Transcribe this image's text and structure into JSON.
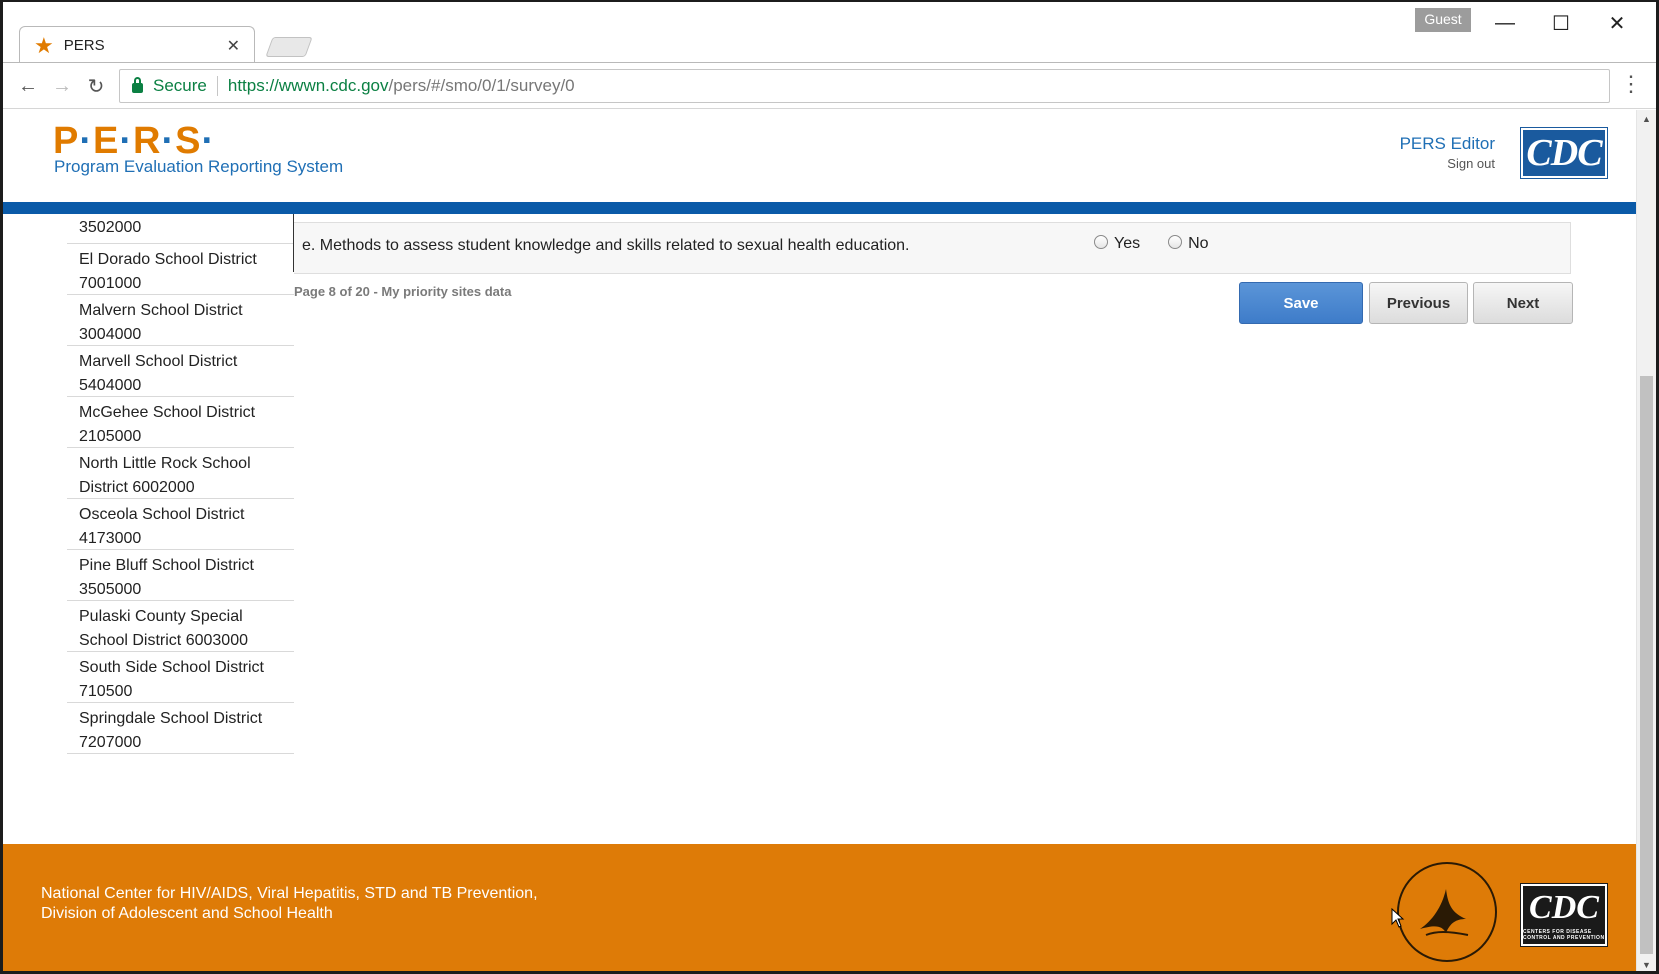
{
  "browser": {
    "tab_title": "PERS",
    "profile": "Guest",
    "secure_label": "Secure",
    "url_host": "https://wwwn.cdc.gov",
    "url_path": "/pers/#/smo/0/1/survey/0"
  },
  "header": {
    "logo_text": "P·E·R·S·",
    "logo_letters": [
      "P",
      "E",
      "R",
      "S"
    ],
    "subtitle": "Program Evaluation Reporting System",
    "user_name": "PERS Editor",
    "signout": "Sign out",
    "cdc_logo": "CDC"
  },
  "sidebar": {
    "items": [
      {
        "line1": "",
        "line2": "3502000"
      },
      {
        "line1": "El Dorado School District",
        "line2": "7001000"
      },
      {
        "line1": "Malvern School District",
        "line2": "3004000"
      },
      {
        "line1": "Marvell School District",
        "line2": "5404000"
      },
      {
        "line1": "McGehee School District",
        "line2": "2105000"
      },
      {
        "line1": "North Little Rock School",
        "line2": "District 6002000"
      },
      {
        "line1": "Osceola School District",
        "line2": "4173000"
      },
      {
        "line1": "Pine Bluff School District",
        "line2": "3505000"
      },
      {
        "line1": "Pulaski County Special",
        "line2": "School District 6003000"
      },
      {
        "line1": "South Side School District",
        "line2": "710500"
      },
      {
        "line1": "Springdale School District",
        "line2": "7207000"
      }
    ]
  },
  "question": {
    "text": "e. Methods to assess student knowledge and skills related to sexual health education.",
    "options": [
      "Yes",
      "No"
    ]
  },
  "pager": {
    "info": "Page 8 of 20 - My priority sites data",
    "save": "Save",
    "previous": "Previous",
    "next": "Next"
  },
  "footer": {
    "line1": "National Center for HIV/AIDS, Viral Hepatitis, STD and TB Prevention,",
    "line2": "Division of Adolescent and School Health",
    "cdc_logo": "CDC",
    "cdc_tagline": "CENTERS FOR DISEASE CONTROL AND PREVENTION"
  },
  "colors": {
    "brand_orange": "#de7b07",
    "brand_blue": "#0a5aa8",
    "save_blue": "#3e7cc9"
  }
}
